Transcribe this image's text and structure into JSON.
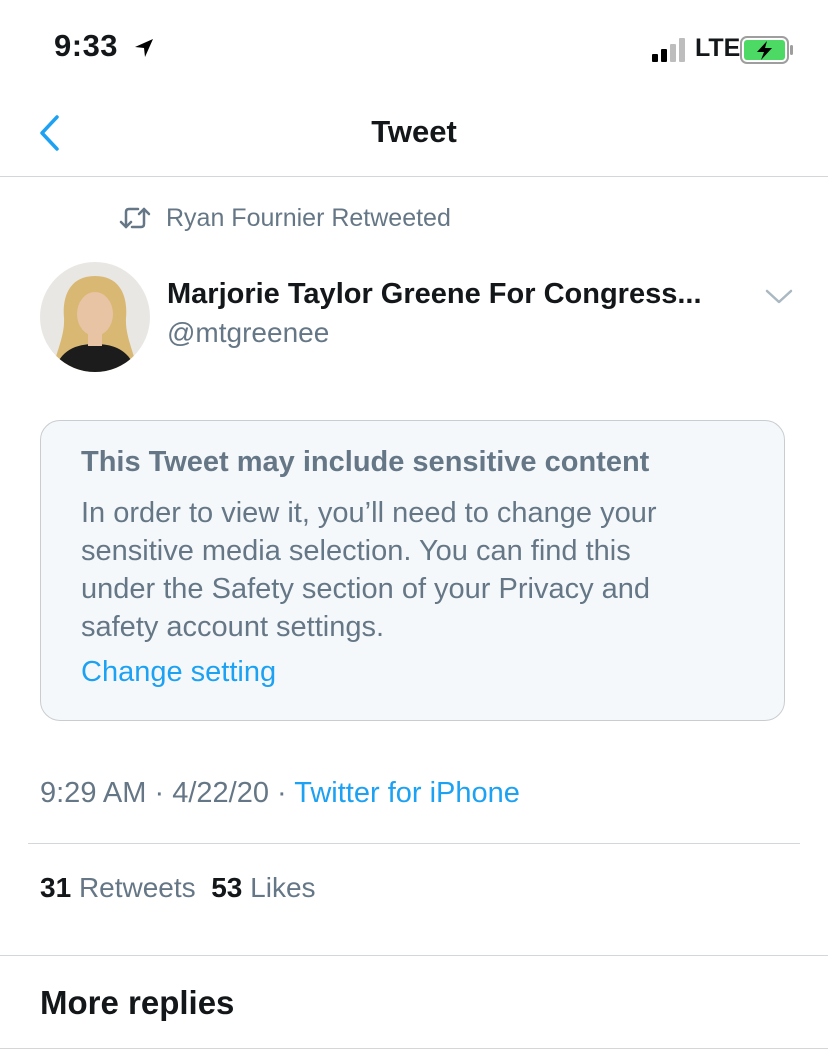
{
  "status_bar": {
    "time": "9:33",
    "network": "LTE"
  },
  "nav": {
    "title": "Tweet"
  },
  "retweet_context": "Ryan Fournier Retweeted",
  "author": {
    "name": "Marjorie Taylor Greene For Congress...",
    "handle": "@mtgreenee"
  },
  "sensitive_notice": {
    "title": "This Tweet may include sensitive content",
    "body_lines": [
      "In order to view it, you’ll need to change your",
      "sensitive media selection. You can find this",
      "under the Safety section of your Privacy and",
      "safety account settings."
    ],
    "link": "Change setting"
  },
  "meta": {
    "time": "9:29 AM",
    "separator": "·",
    "date": "4/22/20",
    "source": "Twitter for iPhone"
  },
  "stats": {
    "retweets_count": "31",
    "retweets_label": "Retweets",
    "likes_count": "53",
    "likes_label": "Likes"
  },
  "more_replies": "More replies",
  "icons": {
    "back": "chevron-left-icon",
    "location": "location-arrow-icon",
    "signal": "cellular-signal-icon",
    "battery": "battery-charging-icon",
    "retweet": "retweet-icon",
    "caret": "chevron-down-icon"
  },
  "colors": {
    "accent": "#1da1f2",
    "secondary_text": "#657786",
    "primary_text": "#14171a",
    "battery_fill": "#4cd964",
    "notice_background": "#f5f8fa"
  }
}
